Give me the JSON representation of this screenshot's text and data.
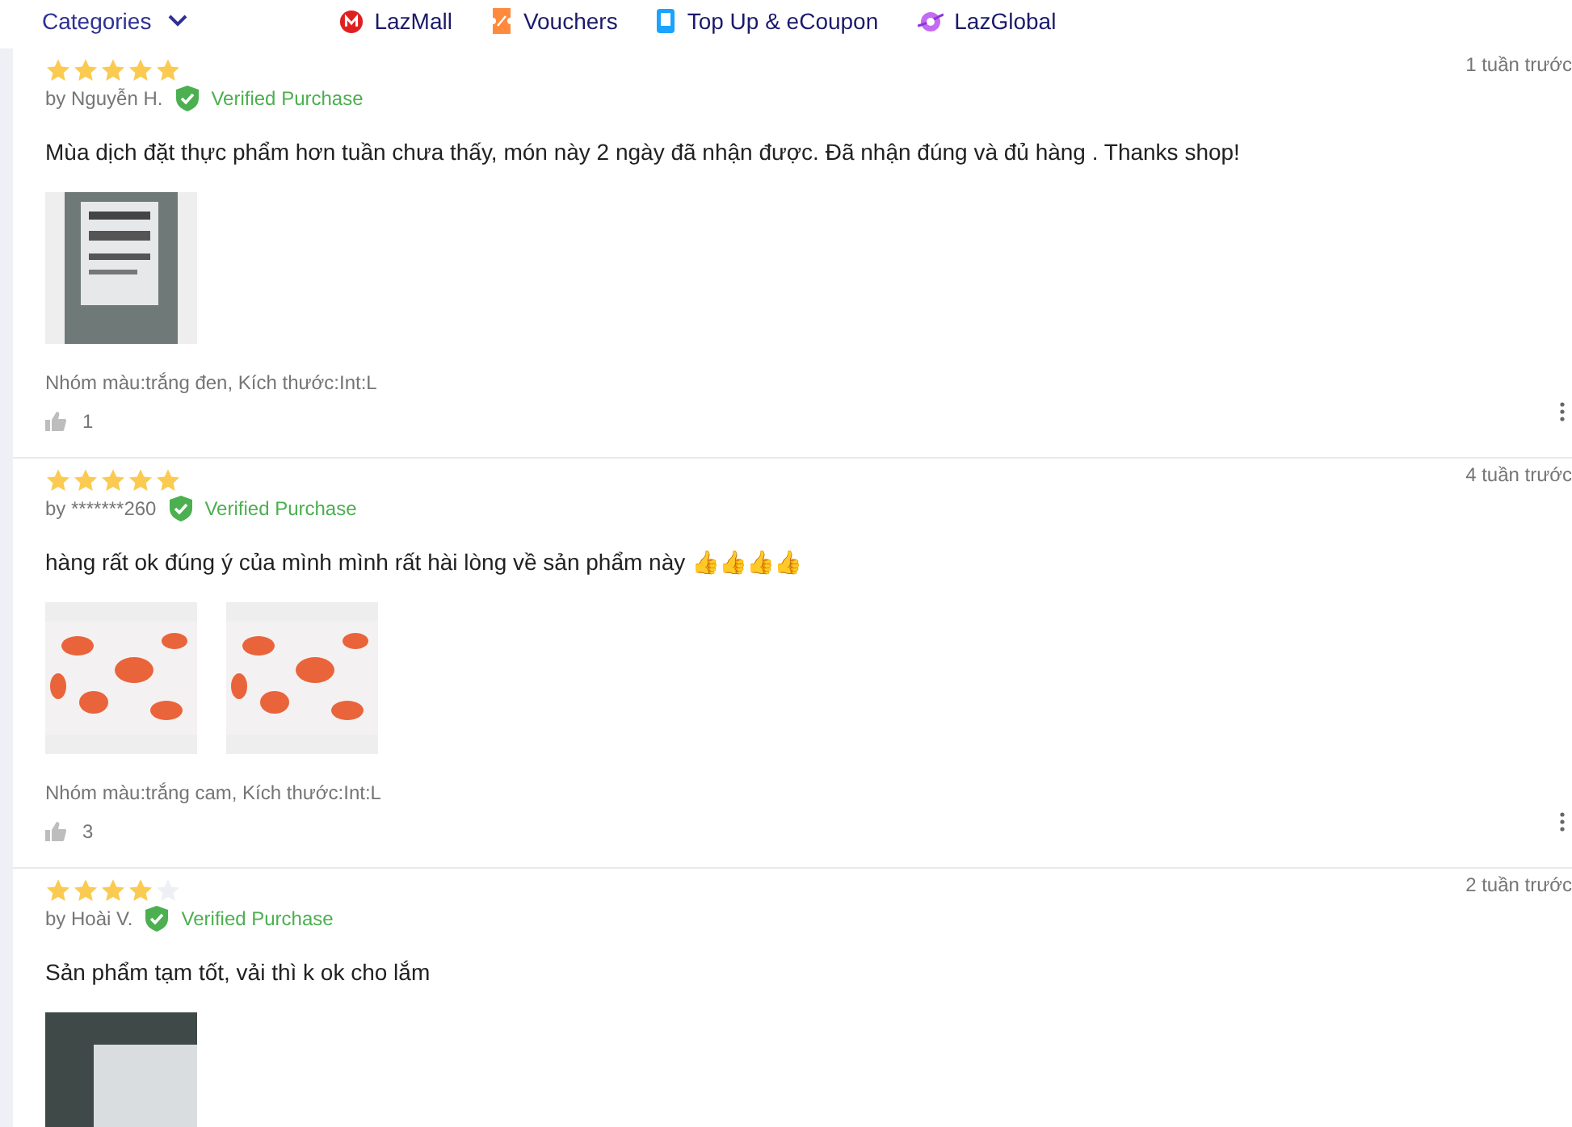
{
  "nav": {
    "categories": "Categories",
    "links": [
      {
        "label": "LazMall",
        "kind": "mall"
      },
      {
        "label": "Vouchers",
        "kind": "voucher"
      },
      {
        "label": "Top Up & eCoupon",
        "kind": "topup"
      },
      {
        "label": "LazGlobal",
        "kind": "global"
      }
    ]
  },
  "reviews": [
    {
      "stars": 5,
      "author": "by Nguyễn H.",
      "verified": "Verified Purchase",
      "date": "1 tuần trước",
      "text": "Mùa dịch đặt thực phẩm hơn tuần chưa thấy, món này 2 ngày đã nhận được. Đã nhận đúng và đủ hàng . Thanks shop!",
      "photos": [
        {
          "kind": "parcel"
        }
      ],
      "variant": "Nhóm màu:trắng đen, Kích thước:Int:L",
      "likes": "1"
    },
    {
      "stars": 5,
      "author": "by *******260",
      "verified": "Verified Purchase",
      "date": "4 tuần trước",
      "text": "hàng rất ok đúng ý của mình mình rất hài lòng về sản phẩm này 👍👍👍👍",
      "photos": [
        {
          "kind": "orange"
        },
        {
          "kind": "orange"
        }
      ],
      "variant": "Nhóm màu:trắng cam, Kích thước:Int:L",
      "likes": "3"
    },
    {
      "stars": 4,
      "author": "by Hoài V.",
      "verified": "Verified Purchase",
      "date": "2 tuần trước",
      "text": "Sản phẩm tạm tốt, vải thì k ok cho lắm",
      "photos": [
        {
          "kind": "dark"
        }
      ]
    }
  ]
}
